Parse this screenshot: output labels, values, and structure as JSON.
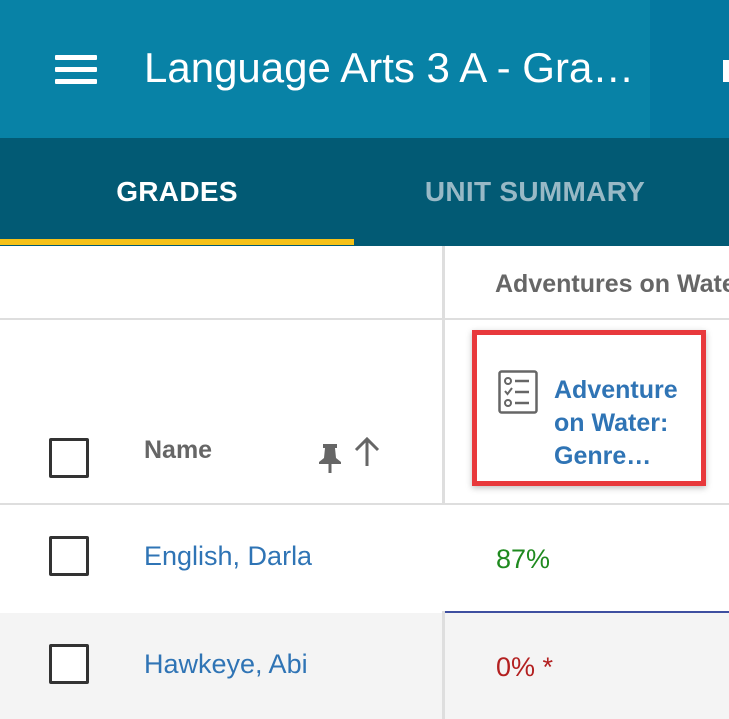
{
  "app_bar": {
    "title": "Language Arts 3 A - Gra…",
    "menu_icon": "hamburger-menu-icon",
    "color": "#0882a6"
  },
  "tabs": [
    {
      "label": "GRADES",
      "active": true
    },
    {
      "label": "UNIT SUMMARY",
      "active": false
    }
  ],
  "tab_bar_color": "#025a74",
  "active_indicator_color": "#f5c118",
  "grid": {
    "unit_header": "Adventures on Water",
    "name_column_label": "Name",
    "pin_icon": "pin-icon",
    "sort_icon": "arrow-up-icon",
    "assignment": {
      "icon": "checklist-icon",
      "title_lines": [
        "Adventure",
        "on Water:",
        "Genre…"
      ],
      "highlight_color": "#e8393c"
    },
    "rows": [
      {
        "name": "English, Darla",
        "score": "87%",
        "score_color": "#1f8a1f"
      },
      {
        "name": "Hawkeye, Abi",
        "score": "0% *",
        "score_color": "#b32020"
      }
    ]
  }
}
